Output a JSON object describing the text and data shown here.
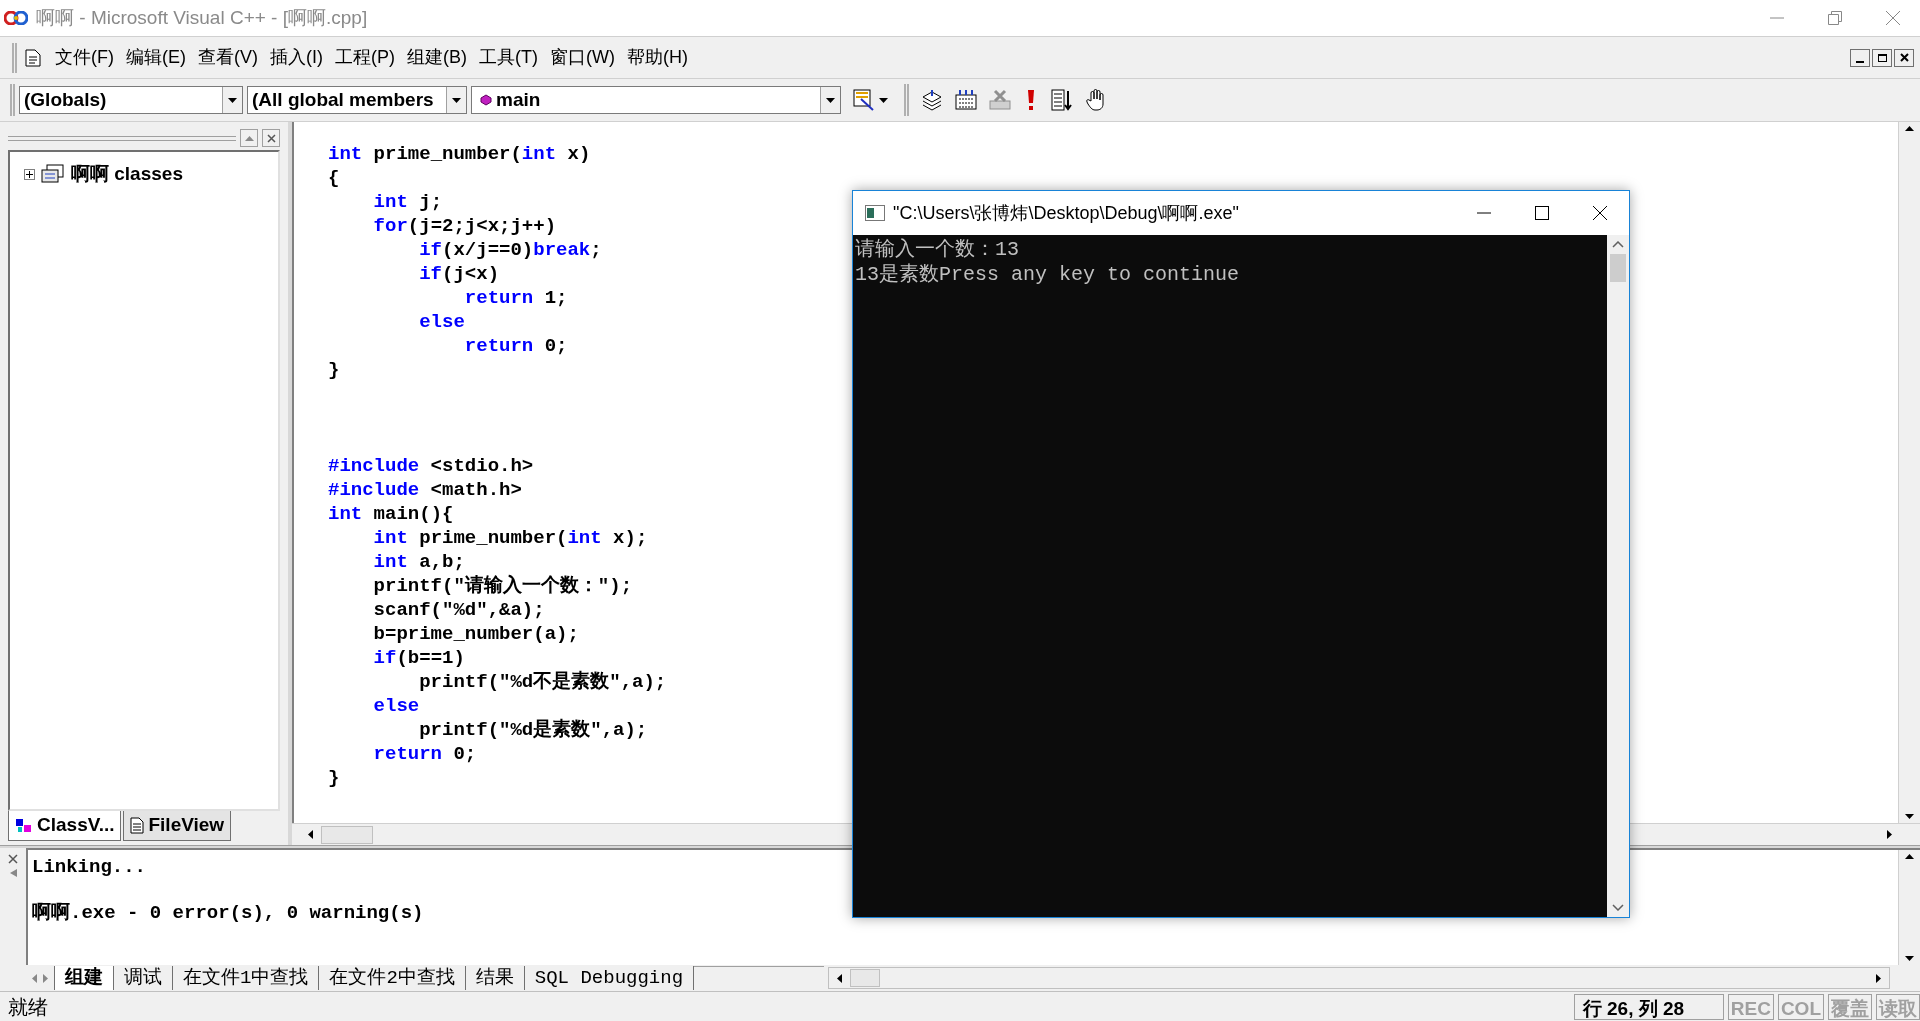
{
  "window": {
    "title": "啊啊 - Microsoft Visual C++ - [啊啊.cpp]"
  },
  "menu": [
    "文件(F)",
    "编辑(E)",
    "查看(V)",
    "插入(I)",
    "工程(P)",
    "组建(B)",
    "工具(T)",
    "窗口(W)",
    "帮助(H)"
  ],
  "toolbar": {
    "class_combo": "(Globals)",
    "members_combo": "(All global members",
    "function_combo": "main"
  },
  "workspace": {
    "tree": [
      {
        "label": "啊啊 classes",
        "expanded": false
      }
    ],
    "tabs": [
      {
        "label": "ClassV...",
        "selected": true
      },
      {
        "label": "FileView",
        "selected": false
      }
    ]
  },
  "editor": {
    "lines": [
      {
        "kind": "code",
        "segments": [
          {
            "text": "int",
            "kind": "keyword"
          },
          {
            "text": " prime_number(",
            "kind": "plain"
          },
          {
            "text": "int",
            "kind": "keyword"
          },
          {
            "text": " x)",
            "kind": "plain"
          }
        ]
      },
      {
        "kind": "code",
        "segments": [
          {
            "text": "{",
            "kind": "plain"
          }
        ]
      },
      {
        "kind": "code",
        "segments": [
          {
            "text": "    int",
            "kind": "keyword"
          },
          {
            "text": " j;",
            "kind": "plain"
          }
        ]
      },
      {
        "kind": "code",
        "segments": [
          {
            "text": "    for",
            "kind": "keyword"
          },
          {
            "text": "(j=2;j<x;j++)",
            "kind": "plain"
          }
        ]
      },
      {
        "kind": "code",
        "segments": [
          {
            "text": "        if",
            "kind": "keyword"
          },
          {
            "text": "(x/j==0)",
            "kind": "plain"
          },
          {
            "text": "break",
            "kind": "keyword"
          },
          {
            "text": ";",
            "kind": "plain"
          }
        ]
      },
      {
        "kind": "code",
        "segments": [
          {
            "text": "        if",
            "kind": "keyword"
          },
          {
            "text": "(j<x)",
            "kind": "plain"
          }
        ]
      },
      {
        "kind": "code",
        "segments": [
          {
            "text": "            return",
            "kind": "keyword"
          },
          {
            "text": " 1;",
            "kind": "plain"
          }
        ]
      },
      {
        "kind": "code",
        "segments": [
          {
            "text": "        else",
            "kind": "keyword"
          }
        ]
      },
      {
        "kind": "code",
        "segments": [
          {
            "text": "            return",
            "kind": "keyword"
          },
          {
            "text": " 0;",
            "kind": "plain"
          }
        ]
      },
      {
        "kind": "code",
        "segments": [
          {
            "text": "}",
            "kind": "plain"
          }
        ]
      },
      {
        "kind": "blank"
      },
      {
        "kind": "blank"
      },
      {
        "kind": "blank"
      },
      {
        "kind": "code",
        "segments": [
          {
            "text": "#include",
            "kind": "keyword"
          },
          {
            "text": " <stdio.h>",
            "kind": "plain"
          }
        ]
      },
      {
        "kind": "code",
        "segments": [
          {
            "text": "#include",
            "kind": "keyword"
          },
          {
            "text": " <math.h>",
            "kind": "plain"
          }
        ]
      },
      {
        "kind": "code",
        "segments": [
          {
            "text": "int",
            "kind": "keyword"
          },
          {
            "text": " main(){",
            "kind": "plain"
          }
        ]
      },
      {
        "kind": "code",
        "segments": [
          {
            "text": "    int",
            "kind": "keyword"
          },
          {
            "text": " prime_number(",
            "kind": "plain"
          },
          {
            "text": "int",
            "kind": "keyword"
          },
          {
            "text": " x);",
            "kind": "plain"
          }
        ]
      },
      {
        "kind": "code",
        "segments": [
          {
            "text": "    int",
            "kind": "keyword"
          },
          {
            "text": " a,b;",
            "kind": "plain"
          }
        ]
      },
      {
        "kind": "code",
        "segments": [
          {
            "text": "    printf(\"请输入一个数：\");",
            "kind": "plain"
          }
        ]
      },
      {
        "kind": "code",
        "segments": [
          {
            "text": "    scanf(\"%d\",&a);",
            "kind": "plain"
          }
        ]
      },
      {
        "kind": "code",
        "segments": [
          {
            "text": "    b=prime_number(a);",
            "kind": "plain"
          }
        ]
      },
      {
        "kind": "code",
        "segments": [
          {
            "text": "    if",
            "kind": "keyword"
          },
          {
            "text": "(b==1)",
            "kind": "plain"
          }
        ]
      },
      {
        "kind": "code",
        "segments": [
          {
            "text": "        printf(\"%d不是素数\",a);",
            "kind": "plain"
          }
        ]
      },
      {
        "kind": "code",
        "segments": [
          {
            "text": "    else",
            "kind": "keyword"
          }
        ]
      },
      {
        "kind": "code",
        "segments": [
          {
            "text": "        printf(\"%d是素数\",a);",
            "kind": "plain"
          }
        ]
      },
      {
        "kind": "code",
        "segments": [
          {
            "text": "    return",
            "kind": "keyword"
          },
          {
            "text": " 0;",
            "kind": "plain"
          }
        ]
      },
      {
        "kind": "code",
        "segments": [
          {
            "text": "}",
            "kind": "plain"
          }
        ]
      }
    ]
  },
  "output": {
    "lines": [
      "Linking...",
      "啊啊.exe - 0 error(s), 0 warning(s)"
    ],
    "tabs": [
      {
        "label": "组建",
        "selected": true
      },
      {
        "label": "调试",
        "selected": false
      },
      {
        "label": "在文件1中查找",
        "selected": false
      },
      {
        "label": "在文件2中查找",
        "selected": false
      },
      {
        "label": "结果",
        "selected": false
      },
      {
        "label": "SQL Debugging",
        "selected": false
      }
    ]
  },
  "console": {
    "title": "\"C:\\Users\\张博炜\\Desktop\\Debug\\啊啊.exe\"",
    "lines": [
      "请输入一个数：13",
      "13是素数Press any key to continue"
    ]
  },
  "status_bar": {
    "message": "就绪",
    "position": "行 26, 列 28",
    "indicators": [
      {
        "label": "REC",
        "disabled": true
      },
      {
        "label": "COL",
        "disabled": true
      },
      {
        "label": "覆盖",
        "disabled": true
      },
      {
        "label": "读取",
        "disabled": true
      }
    ]
  }
}
